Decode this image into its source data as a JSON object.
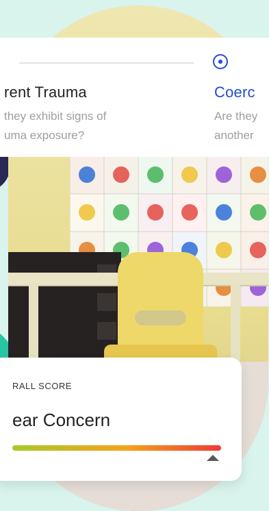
{
  "questions": {
    "left": {
      "title": "rent Trauma",
      "subtitle": "they exhibit signs of\numa exposure?"
    },
    "right": {
      "title": "Coerc",
      "subtitle": "Are they\nanother"
    }
  },
  "overall": {
    "label": "RALL SCORE",
    "value": "ear Concern",
    "gauge_level": 0.96
  },
  "icons": {
    "radio": "radio-selected-icon",
    "pointer": "triangle-pointer-icon"
  },
  "colors": {
    "accent": "#2549d6",
    "mint_background": "#d9f3ed",
    "teal_blob": "#28c7a3",
    "navy_blob": "#2a2855"
  }
}
